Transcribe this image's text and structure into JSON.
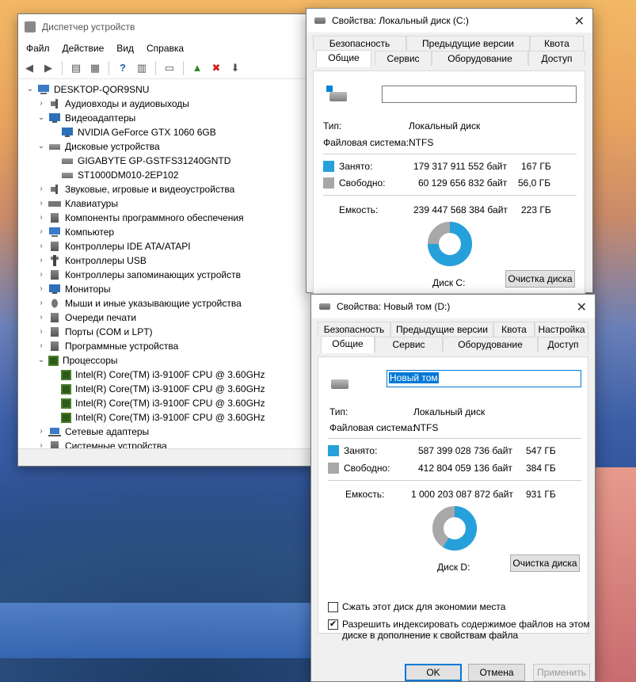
{
  "device_manager": {
    "title": "Диспетчер устройств",
    "menu": [
      "Файл",
      "Действие",
      "Вид",
      "Справка"
    ],
    "tree": [
      {
        "label": "DESKTOP-QOR9SNU",
        "level": 0,
        "expanded": true,
        "icon": "computer-icon"
      },
      {
        "label": "Аудиовходы и аудиовыходы",
        "level": 1,
        "expanded": false,
        "icon": "audio-icon"
      },
      {
        "label": "Видеоадаптеры",
        "level": 1,
        "expanded": true,
        "icon": "display-adapter-icon"
      },
      {
        "label": "NVIDIA GeForce GTX 1060 6GB",
        "level": 2,
        "icon": "display-adapter-icon"
      },
      {
        "label": "Дисковые устройства",
        "level": 1,
        "expanded": true,
        "icon": "disk-icon"
      },
      {
        "label": "GIGABYTE GP-GSTFS31240GNTD",
        "level": 2,
        "icon": "disk-icon"
      },
      {
        "label": "ST1000DM010-2EP102",
        "level": 2,
        "icon": "disk-icon"
      },
      {
        "label": "Звуковые, игровые и видеоустройства",
        "level": 1,
        "expanded": false,
        "icon": "audio-icon"
      },
      {
        "label": "Клавиатуры",
        "level": 1,
        "expanded": false,
        "icon": "keyboard-icon"
      },
      {
        "label": "Компоненты программного обеспечения",
        "level": 1,
        "expanded": false,
        "icon": "generic-icon"
      },
      {
        "label": "Компьютер",
        "level": 1,
        "expanded": false,
        "icon": "computer-icon"
      },
      {
        "label": "Контроллеры IDE ATA/ATAPI",
        "level": 1,
        "expanded": false,
        "icon": "generic-icon"
      },
      {
        "label": "Контроллеры USB",
        "level": 1,
        "expanded": false,
        "icon": "usb-icon"
      },
      {
        "label": "Контроллеры запоминающих устройств",
        "level": 1,
        "expanded": false,
        "icon": "generic-icon"
      },
      {
        "label": "Мониторы",
        "level": 1,
        "expanded": false,
        "icon": "display-adapter-icon"
      },
      {
        "label": "Мыши и иные указывающие устройства",
        "level": 1,
        "expanded": false,
        "icon": "mouse-icon"
      },
      {
        "label": "Очереди печати",
        "level": 1,
        "expanded": false,
        "icon": "generic-icon"
      },
      {
        "label": "Порты (COM и LPT)",
        "level": 1,
        "expanded": false,
        "icon": "generic-icon"
      },
      {
        "label": "Программные устройства",
        "level": 1,
        "expanded": false,
        "icon": "generic-icon"
      },
      {
        "label": "Процессоры",
        "level": 1,
        "expanded": true,
        "icon": "cpu-icon"
      },
      {
        "label": "Intel(R) Core(TM) i3-9100F CPU @ 3.60GHz",
        "level": 2,
        "icon": "cpu-icon"
      },
      {
        "label": "Intel(R) Core(TM) i3-9100F CPU @ 3.60GHz",
        "level": 2,
        "icon": "cpu-icon"
      },
      {
        "label": "Intel(R) Core(TM) i3-9100F CPU @ 3.60GHz",
        "level": 2,
        "icon": "cpu-icon"
      },
      {
        "label": "Intel(R) Core(TM) i3-9100F CPU @ 3.60GHz",
        "level": 2,
        "icon": "cpu-icon"
      },
      {
        "label": "Сетевые адаптеры",
        "level": 1,
        "expanded": false,
        "icon": "network-icon"
      },
      {
        "label": "Системные устройства",
        "level": 1,
        "expanded": false,
        "icon": "generic-icon"
      }
    ]
  },
  "disk_c": {
    "title": "Свойства: Локальный диск (C:)",
    "tabs_row1": [
      "Безопасность",
      "Предыдущие версии",
      "Квота"
    ],
    "tabs_row2": [
      "Общие",
      "Сервис",
      "Оборудование",
      "Доступ"
    ],
    "active_tab": "Общие",
    "name_value": "",
    "type_label": "Тип:",
    "type_value": "Локальный диск",
    "fs_label": "Файловая система:",
    "fs_value": "NTFS",
    "used_label": "Занято:",
    "used_bytes": "179 317 911 552 байт",
    "used_gb": "167 ГБ",
    "free_label": "Свободно:",
    "free_bytes": "60 129 656 832 байт",
    "free_gb": "56,0 ГБ",
    "capacity_label": "Емкость:",
    "capacity_bytes": "239 447 568 384 байт",
    "capacity_gb": "223 ГБ",
    "disk_label": "Диск C:",
    "cleanup_button": "Очистка диска",
    "used_fraction": 0.749
  },
  "disk_d": {
    "title": "Свойства: Новый том (D:)",
    "tabs_row1": [
      "Безопасность",
      "Предыдущие версии",
      "Квота",
      "Настройка"
    ],
    "tabs_row2": [
      "Общие",
      "Сервис",
      "Оборудование",
      "Доступ"
    ],
    "active_tab": "Общие",
    "name_value": "Новый том",
    "type_label": "Тип:",
    "type_value": "Локальный диск",
    "fs_label": "Файловая система:",
    "fs_value": "NTFS",
    "used_label": "Занято:",
    "used_bytes": "587 399 028 736 байт",
    "used_gb": "547 ГБ",
    "free_label": "Свободно:",
    "free_bytes": "412 804 059 136 байт",
    "free_gb": "384 ГБ",
    "capacity_label": "Емкость:",
    "capacity_bytes": "1 000 203 087 872 байт",
    "capacity_gb": "931 ГБ",
    "disk_label": "Диск D:",
    "cleanup_button": "Очистка диска",
    "compress_label": "Сжать этот диск для экономии места",
    "compress_checked": false,
    "index_label_line1": "Разрешить индексировать содержимое файлов на этом",
    "index_label_line2": "диске в дополнение к свойствам файла",
    "index_checked": true,
    "ok_button": "OK",
    "cancel_button": "Отмена",
    "apply_button": "Применить",
    "used_fraction": 0.587
  },
  "colors": {
    "used": "#26a0da",
    "free": "#a8a8a8",
    "accent": "#0078d7"
  }
}
